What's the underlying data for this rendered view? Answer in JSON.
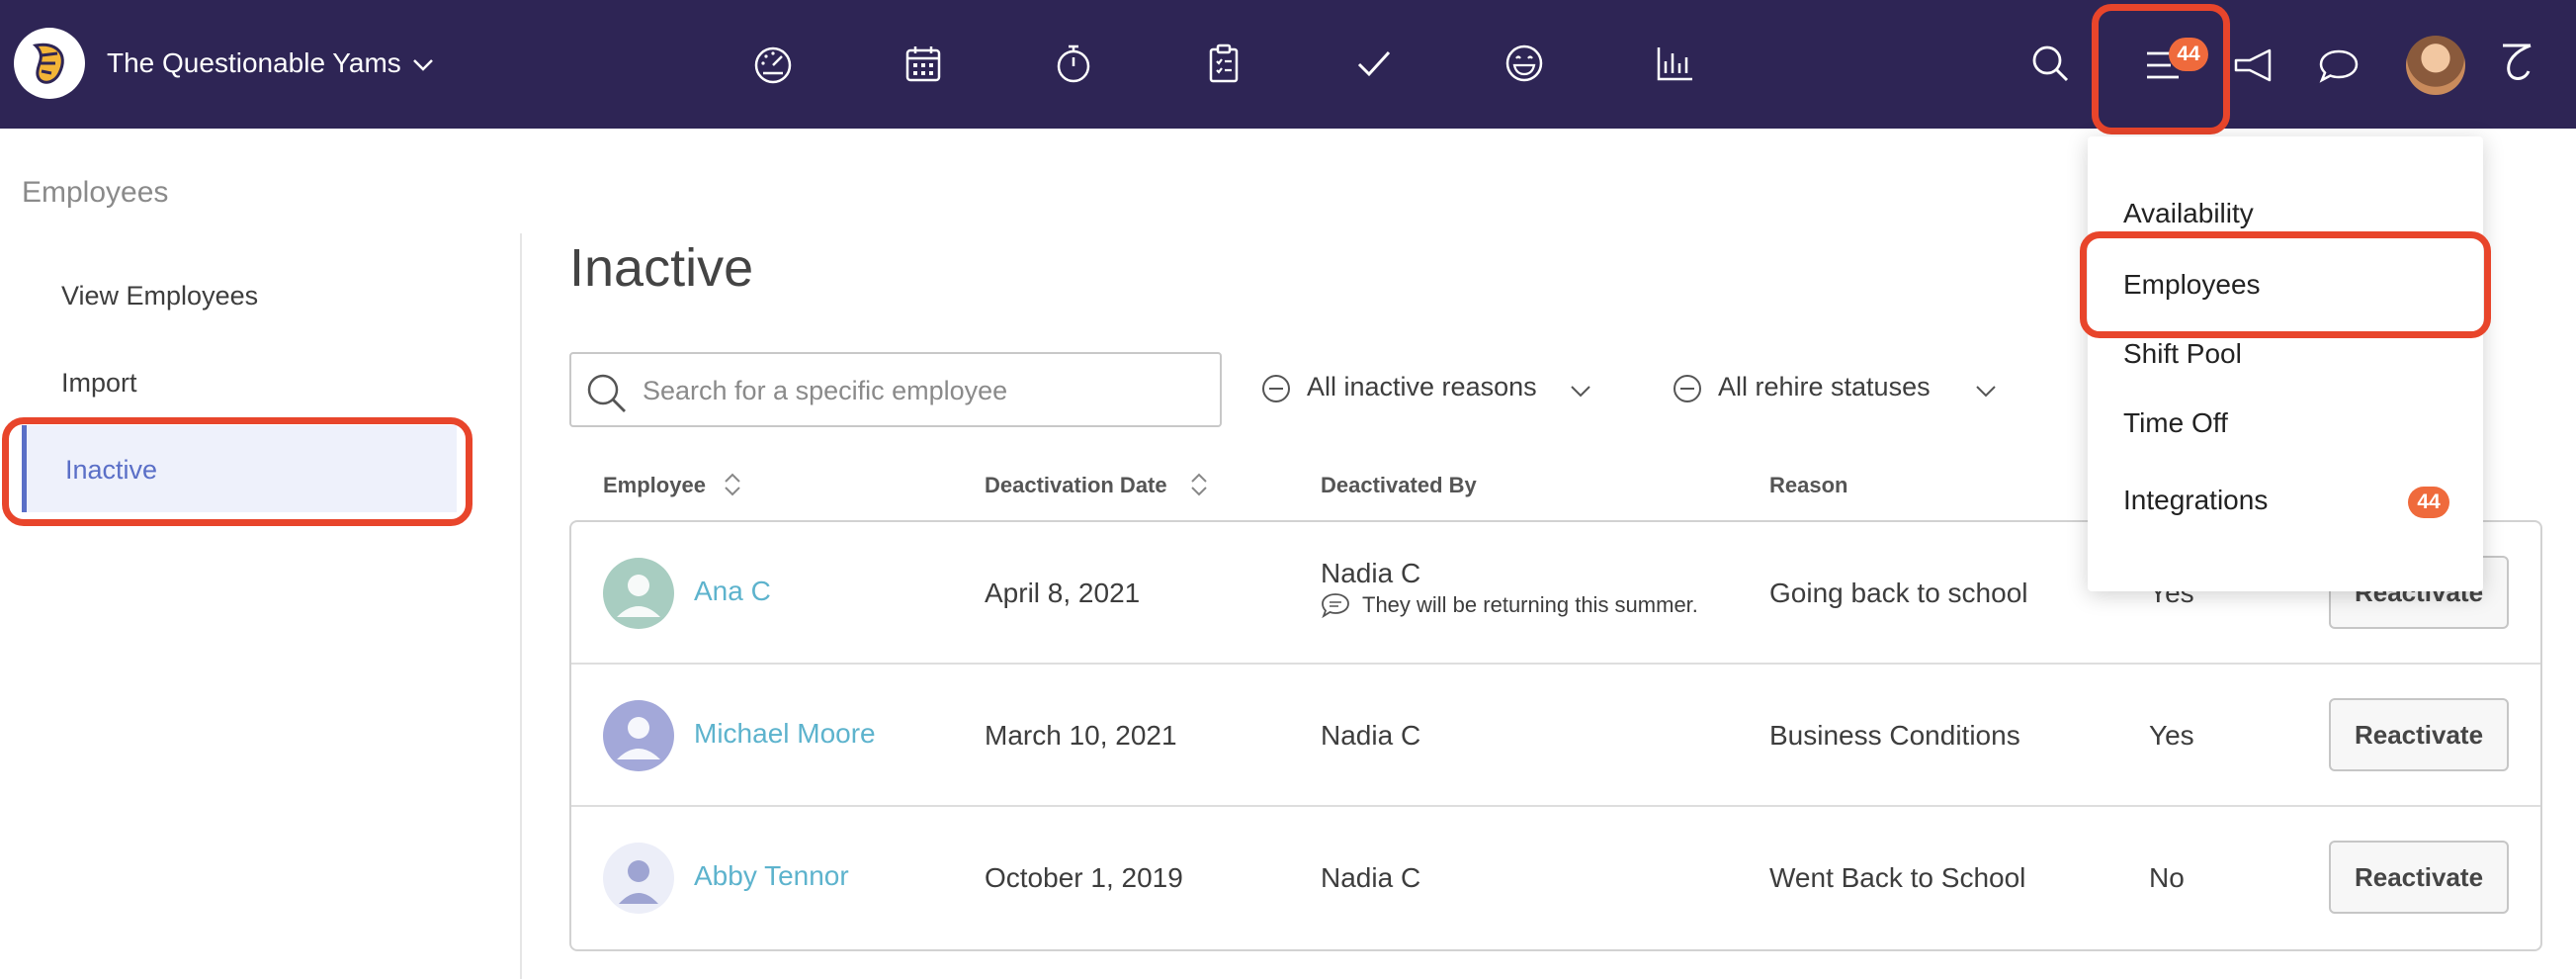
{
  "org": {
    "name": "The Questionable Yams"
  },
  "nav": {
    "icons": [
      "dashboard-icon",
      "calendar-icon",
      "stopwatch-icon",
      "clipboard-icon",
      "check-icon",
      "smiley-icon",
      "bar-chart-icon"
    ],
    "menu_badge": "44",
    "right_icons": [
      "search-icon",
      "menu-icon",
      "megaphone-icon",
      "chat-icon",
      "avatar",
      "brand-icon"
    ]
  },
  "sidebar": {
    "title": "Employees",
    "items": [
      {
        "label": "View Employees"
      },
      {
        "label": "Import"
      },
      {
        "label": "Inactive"
      }
    ]
  },
  "main": {
    "title": "Inactive",
    "search": {
      "placeholder": "Search for a specific employee",
      "value": ""
    },
    "filters": [
      {
        "label": "All inactive reasons"
      },
      {
        "label": "All rehire statuses"
      }
    ],
    "columns": [
      "Employee",
      "Deactivation Date",
      "Deactivated By",
      "Reason"
    ],
    "rows": [
      {
        "name": "Ana C",
        "date": "April 8, 2021",
        "by": "Nadia C",
        "note": "They will be returning this summer.",
        "reason": "Going back to school",
        "rehire": "Yes",
        "action": "Reactivate"
      },
      {
        "name": "Michael Moore",
        "date": "March 10, 2021",
        "by": "Nadia C",
        "note": "",
        "reason": "Business Conditions",
        "rehire": "Yes",
        "action": "Reactivate"
      },
      {
        "name": "Abby Tennor",
        "date": "October 1, 2019",
        "by": "Nadia C",
        "note": "",
        "reason": "Went Back to School",
        "rehire": "No",
        "action": "Reactivate"
      }
    ]
  },
  "dropdown": {
    "items": [
      {
        "label": "Availability"
      },
      {
        "label": "Employees"
      },
      {
        "label": "Shift Pool"
      },
      {
        "label": "Time Off"
      },
      {
        "label": "Integrations",
        "badge": "44"
      }
    ]
  },
  "colors": {
    "nav_bg": "#2e2555",
    "highlight": "#e8452b",
    "link": "#5db3cd",
    "badge": "#ef6a3c",
    "active": "#5a6fc7"
  }
}
